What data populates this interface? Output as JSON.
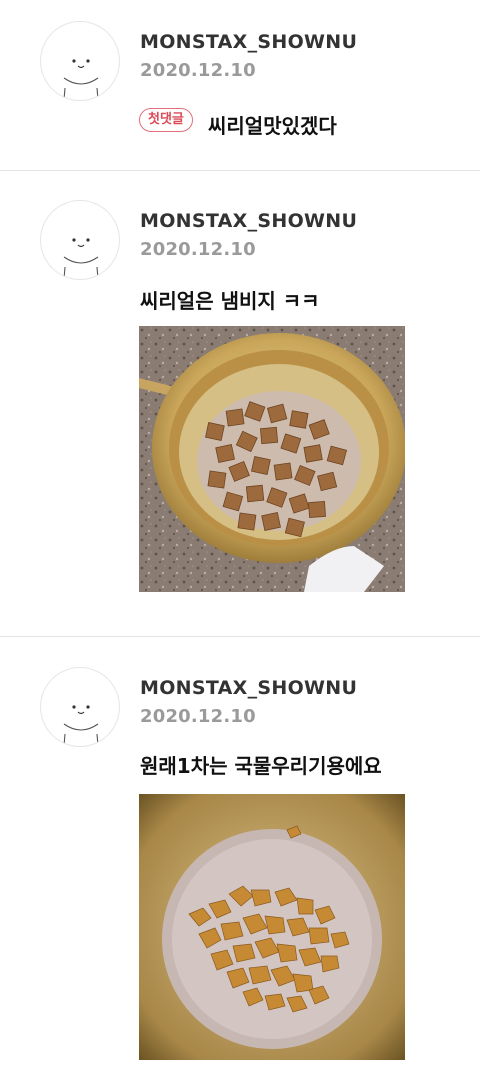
{
  "comments": [
    {
      "username": "MONSTAX_SHOWNU",
      "date": "2020.12.10",
      "badge": "첫댓글",
      "text": "씨리얼맛있겠다",
      "has_photo": false
    },
    {
      "username": "MONSTAX_SHOWNU",
      "date": "2020.12.10",
      "text": "씨리얼은 냄비지 ㅋㅋ",
      "has_photo": true,
      "photo": "square cereal in a gold aluminum pot with milk on granite counter"
    },
    {
      "username": "MONSTAX_SHOWNU",
      "date": "2020.12.10",
      "text": "원래1차는 국물우리기용에요",
      "has_photo": true,
      "photo": "corn flakes floating in milk inside a gold aluminum pot"
    }
  ],
  "colors": {
    "username": "#333333",
    "date": "#9a9a9a",
    "badge": "#dc4b57",
    "divider": "#e3e3e3"
  },
  "icons": {
    "avatar": "cute-face-icon"
  }
}
